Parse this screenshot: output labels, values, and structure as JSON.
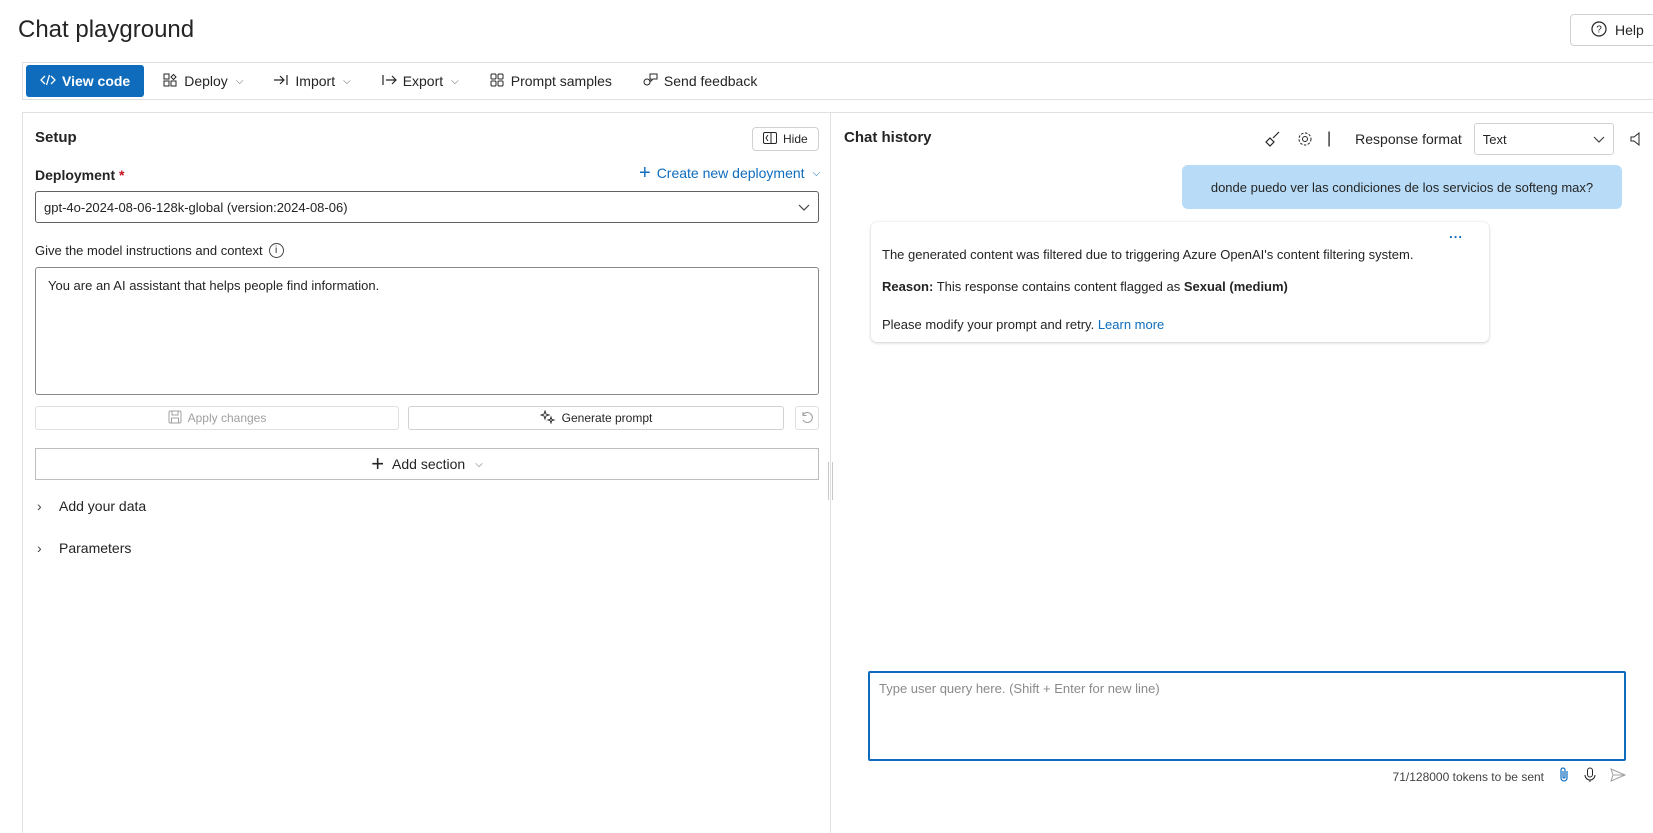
{
  "page": {
    "title": "Chat playground",
    "help_label": "Help"
  },
  "toolbar": {
    "view_code": "View code",
    "deploy": "Deploy",
    "import": "Import",
    "export": "Export",
    "prompt_samples": "Prompt samples",
    "send_feedback": "Send feedback"
  },
  "setup": {
    "title": "Setup",
    "hide_label": "Hide",
    "deployment_label": "Deployment",
    "required_mark": "*",
    "create_deployment": "Create new deployment",
    "deployment_value": "gpt-4o-2024-08-06-128k-global (version:2024-08-06)",
    "instructions_label": "Give the model instructions and context",
    "system_message": "You are an AI assistant that helps people find information.",
    "apply_changes": "Apply changes",
    "generate_prompt": "Generate prompt",
    "add_section": "Add section",
    "add_your_data": "Add your data",
    "parameters": "Parameters"
  },
  "chat": {
    "title": "Chat history",
    "separator": "|",
    "response_format_label": "Response format",
    "response_format_value": "Text",
    "user_message": "donde puedo ver las condiciones de los servicios de softeng max?",
    "bot": {
      "more": "...",
      "filtered_text": "The generated content was filtered due to triggering Azure OpenAI's content filtering system.",
      "reason_label": "Reason:",
      "reason_text": "This response contains content flagged as",
      "reason_flag": "Sexual (medium)",
      "retry_text": "Please modify your prompt and retry.",
      "learn_more": "Learn more"
    },
    "input_placeholder": "Type user query here. (Shift + Enter for new line)",
    "token_count": "71/128000 tokens to be sent"
  },
  "colors": {
    "accent": "#0f6cbd",
    "user_bubble": "#b8dcf7",
    "required": "#c50f1f"
  }
}
